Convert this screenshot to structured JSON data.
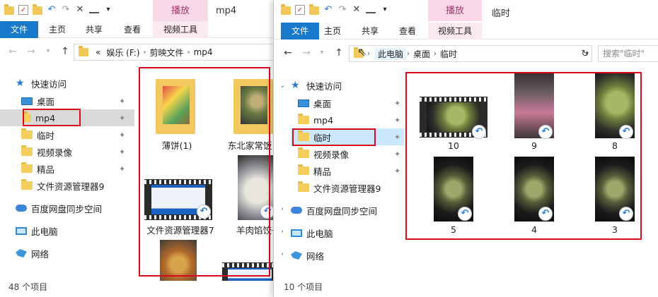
{
  "w1": {
    "ctx_tab": "播放",
    "title": "mp4",
    "ribbon_tabs": [
      "文件",
      "主页",
      "共享",
      "查看",
      "视频工具"
    ],
    "addr_overflow": "«",
    "breadcrumb": [
      "娱乐 (F:)",
      "剪映文件",
      "mp4"
    ],
    "nav": [
      {
        "label": "快速访问"
      },
      {
        "label": "桌面"
      },
      {
        "label": "mp4"
      },
      {
        "label": "临时"
      },
      {
        "label": "视频录像"
      },
      {
        "label": "精品"
      },
      {
        "label": "文件资源管理器9"
      },
      {
        "label": "百度网盘同步空间"
      },
      {
        "label": "此电脑"
      },
      {
        "label": "网络"
      }
    ],
    "items": [
      "薄饼(1)",
      "东北家常饭",
      "文件资源管理器7",
      "羊肉馅饺子"
    ],
    "status": "48 个项目"
  },
  "w2": {
    "ctx_tab": "播放",
    "title": "临时",
    "ribbon_tabs": [
      "文件",
      "主页",
      "共享",
      "查看",
      "视频工具"
    ],
    "breadcrumb": [
      "此电脑",
      "桌面",
      "临时"
    ],
    "search_placeholder": "搜索\"临时\"",
    "nav": [
      {
        "label": "快速访问"
      },
      {
        "label": "桌面"
      },
      {
        "label": "mp4"
      },
      {
        "label": "临时"
      },
      {
        "label": "视频录像"
      },
      {
        "label": "精品"
      },
      {
        "label": "文件资源管理器9"
      },
      {
        "label": "百度网盘同步空间"
      },
      {
        "label": "此电脑"
      },
      {
        "label": "网络"
      }
    ],
    "items": [
      "10",
      "9",
      "8",
      "5",
      "4",
      "3"
    ],
    "status": "10 个项目"
  },
  "icons": {
    "undo": "↶",
    "redo": "↷",
    "delete": "✕",
    "back": "←",
    "forward": "→",
    "up": "↑",
    "refresh": "↻",
    "star": "★",
    "pin": "📌",
    "shortcut": "↶",
    "chevron_right": "›",
    "expand": "›",
    "expand_down": "⌄",
    "dropdown": "▾",
    "check": "✓"
  },
  "colors": {
    "file_tab": "#1979ca",
    "context_tab": "#f8d7e7",
    "selected_nav": "#cce8ff",
    "annotation_red": "#d80a1e"
  }
}
